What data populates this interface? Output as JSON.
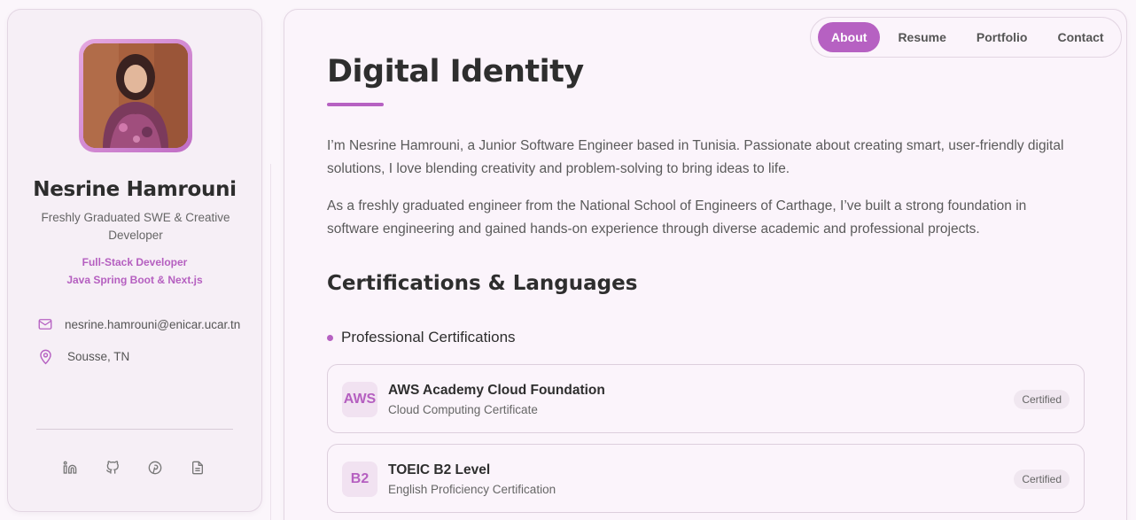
{
  "profile": {
    "name": "Nesrine Hamrouni",
    "tagline": "Freshly Graduated SWE & Creative Developer",
    "role_line1": "Full-Stack Developer",
    "role_line2": "Java Spring Boot & Next.js",
    "email": "nesrine.hamrouni@enicar.ucar.tn",
    "location": "Sousse, TN",
    "social_icons": [
      "linkedin-icon",
      "github-icon",
      "pinterest-icon",
      "document-icon"
    ]
  },
  "nav": {
    "tabs": [
      {
        "label": "About",
        "active": true
      },
      {
        "label": "Resume",
        "active": false
      },
      {
        "label": "Portfolio",
        "active": false
      },
      {
        "label": "Contact",
        "active": false
      }
    ]
  },
  "about": {
    "title": "Digital Identity",
    "paragraph1": "I’m Nesrine Hamrouni, a Junior Software Engineer based in Tunisia. Passionate about creating smart, user-friendly digital solutions, I love blending creativity and problem-solving to bring ideas to life.",
    "paragraph2": "As a freshly graduated engineer from the National School of Engineers of Carthage, I’ve built a strong foundation in software engineering and gained hands-on experience through diverse academic and professional projects."
  },
  "certifications": {
    "section_title": "Certifications & Languages",
    "subsection_title": "Professional Certifications",
    "items": [
      {
        "badge": "AWS",
        "title": "AWS Academy Cloud Foundation",
        "subtitle": "Cloud Computing Certificate",
        "status": "Certified"
      },
      {
        "badge": "B2",
        "title": "TOEIC B2 Level",
        "subtitle": "English Proficiency Certification",
        "status": "Certified"
      }
    ]
  },
  "colors": {
    "accent": "#b661c2",
    "background": "#fbf4fb"
  }
}
